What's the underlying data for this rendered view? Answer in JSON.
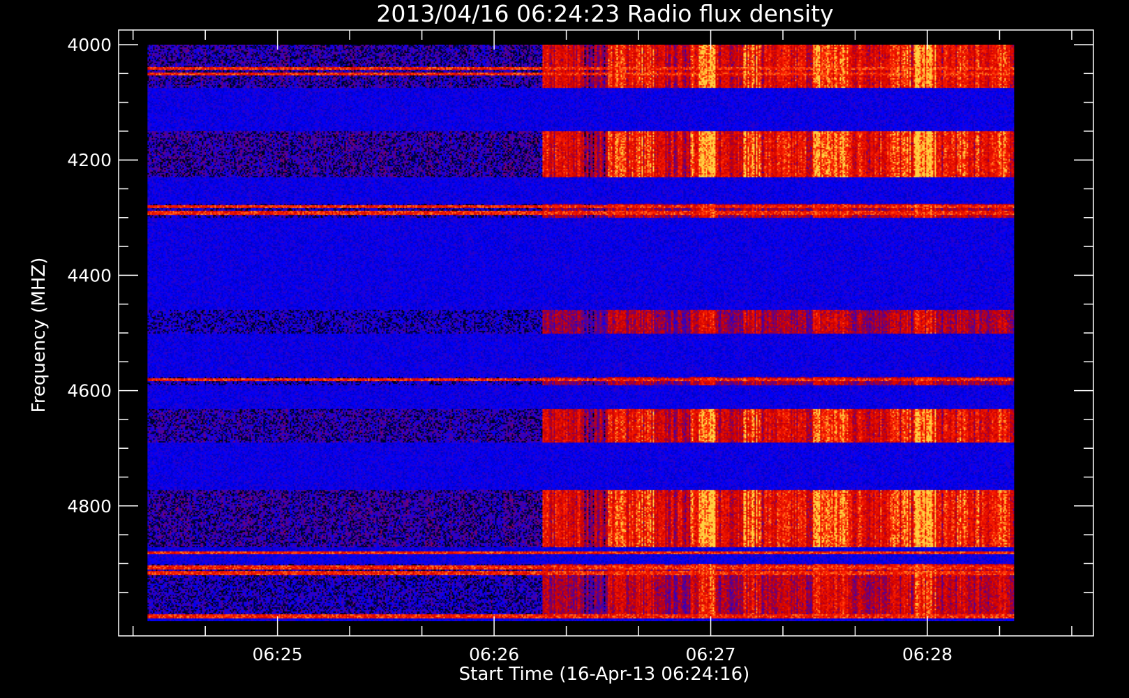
{
  "chart_data": {
    "type": "heatmap",
    "title": "2013/04/16 06:24:23 Radio flux density",
    "xlabel": "Start Time (16-Apr-13 06:24:16)",
    "ylabel": "Frequency (MHZ)",
    "x_range_seconds": [
      0,
      270
    ],
    "data_extent_seconds": [
      8,
      248
    ],
    "x_major_tick_seconds": [
      44,
      104,
      164,
      224
    ],
    "x_minor_tick_seconds": [
      4,
      24,
      44,
      64,
      84,
      104,
      124,
      144,
      164,
      184,
      204,
      224,
      244,
      264
    ],
    "x_tick_labels": [
      "06:25",
      "06:26",
      "06:27",
      "06:28"
    ],
    "y_range_mhz": [
      4000,
      5000
    ],
    "y_reversed": true,
    "y_major_ticks": [
      4000,
      4200,
      4400,
      4600,
      4800
    ],
    "y_tick_labels": [
      "4000",
      "4200",
      "4400",
      "4600",
      "4800"
    ],
    "y_minor_ticks": [
      4000,
      4050,
      4100,
      4150,
      4200,
      4250,
      4300,
      4350,
      4400,
      4450,
      4500,
      4550,
      4600,
      4650,
      4700,
      4750,
      4800,
      4850,
      4900,
      4950
    ],
    "colormap": [
      "#000000",
      "#0000ff",
      "#cc0000",
      "#ff2000",
      "#ffd040"
    ],
    "background_level": 0.25,
    "emission_time_bands_seconds": [
      {
        "start": 8,
        "end": 117,
        "level": 0.1
      },
      {
        "start": 117,
        "end": 128,
        "level": 0.45
      },
      {
        "start": 128,
        "end": 135,
        "level": 0.3
      },
      {
        "start": 135,
        "end": 148,
        "level": 0.65
      },
      {
        "start": 148,
        "end": 158,
        "level": 0.4
      },
      {
        "start": 158,
        "end": 165,
        "level": 0.9
      },
      {
        "start": 165,
        "end": 172,
        "level": 0.5
      },
      {
        "start": 172,
        "end": 178,
        "level": 0.75
      },
      {
        "start": 178,
        "end": 192,
        "level": 0.5
      },
      {
        "start": 192,
        "end": 202,
        "level": 0.8
      },
      {
        "start": 202,
        "end": 212,
        "level": 0.55
      },
      {
        "start": 212,
        "end": 220,
        "level": 0.65
      },
      {
        "start": 220,
        "end": 226,
        "level": 1.0
      },
      {
        "start": 226,
        "end": 230,
        "level": 0.5
      },
      {
        "start": 230,
        "end": 248,
        "level": 0.6
      }
    ],
    "emission_frequency_bands_mhz": [
      {
        "start": 4000,
        "end": 4075,
        "gain": 0.9
      },
      {
        "start": 4150,
        "end": 4230,
        "gain": 1.0
      },
      {
        "start": 4275,
        "end": 4300,
        "gain": 0.55
      },
      {
        "start": 4460,
        "end": 4500,
        "gain": 0.5
      },
      {
        "start": 4575,
        "end": 4590,
        "gain": 0.45
      },
      {
        "start": 4630,
        "end": 4690,
        "gain": 0.85
      },
      {
        "start": 4770,
        "end": 4870,
        "gain": 1.0
      },
      {
        "start": 4900,
        "end": 4995,
        "gain": 0.6
      }
    ],
    "narrowband_lines_mhz": [
      4040,
      4050,
      4280,
      4290,
      4580,
      4880,
      4905,
      4915,
      4990
    ]
  }
}
